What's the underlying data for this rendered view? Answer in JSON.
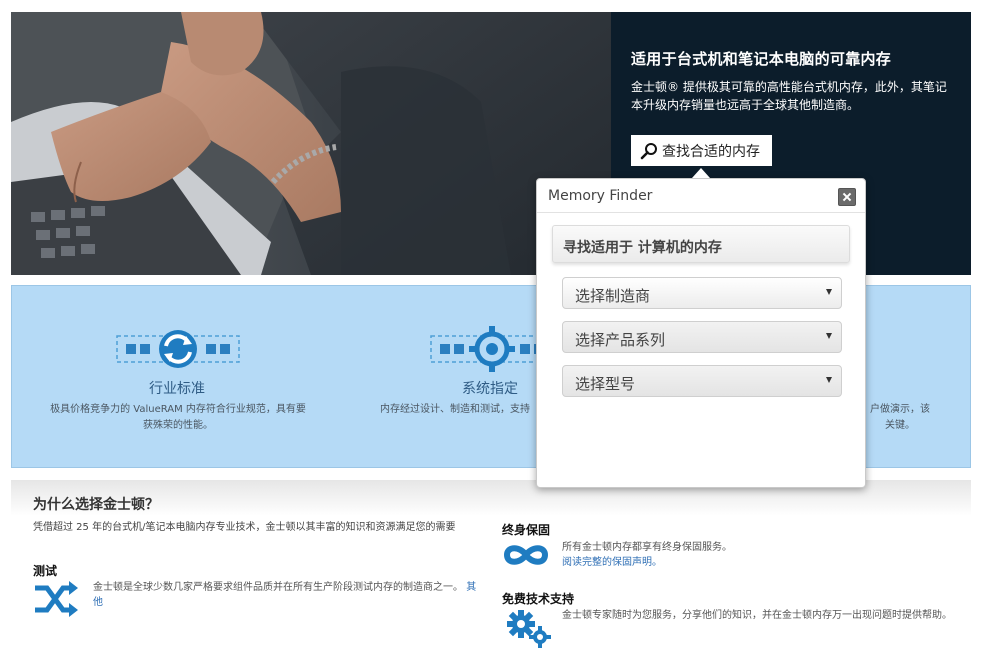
{
  "hero": {
    "title": "适用于台式机和笔记本电脑的可靠内存",
    "description": "金士顿® 提供极其可靠的高性能台式机内存，此外，其笔记本升级内存销量也远高于全球其他制造商。",
    "finder_button": "查找合适的内存"
  },
  "features": [
    {
      "title": "行业标准",
      "description": "极具价格竞争力的 ValueRAM 内存符合行业规范，具有要获殊荣的性能。"
    },
    {
      "title": "系统指定",
      "description": "内存经过设计、制造和测试，支持"
    },
    {
      "title": "",
      "description": "户做演示，该关键。"
    }
  ],
  "memory_finder": {
    "title": "Memory Finder",
    "heading": "寻找适用于 计算机的内存",
    "selects": [
      {
        "value": "选择制造商"
      },
      {
        "value": "选择产品系列"
      },
      {
        "value": "选择型号"
      }
    ]
  },
  "why": {
    "title": "为什么选择金士顿？",
    "intro": "凭借超过 25 年的台式机/笔记本电脑内存专业技术，金士顿以其丰富的知识和资源满足您的需要",
    "items": [
      {
        "title": "测试",
        "description": "金士顿是全球少数几家严格要求组件品质并在所有生产阶段测试内存的制造商之一。",
        "link": "其他"
      },
      {
        "title": "终身保固",
        "description": "所有金士顿内存都享有终身保固服务。",
        "link": "阅读完整的保固声明。"
      },
      {
        "title": "免费技术支持",
        "description": "金士顿专家随时为您服务，分享他们的知识，并在金士顿内存万一出现问题时提供帮助。"
      }
    ]
  },
  "colors": {
    "hero_bg": "#0c1d2b",
    "band_bg": "#b5daf6",
    "icon_blue": "#1f7cc1",
    "link": "#2f6fb5"
  }
}
